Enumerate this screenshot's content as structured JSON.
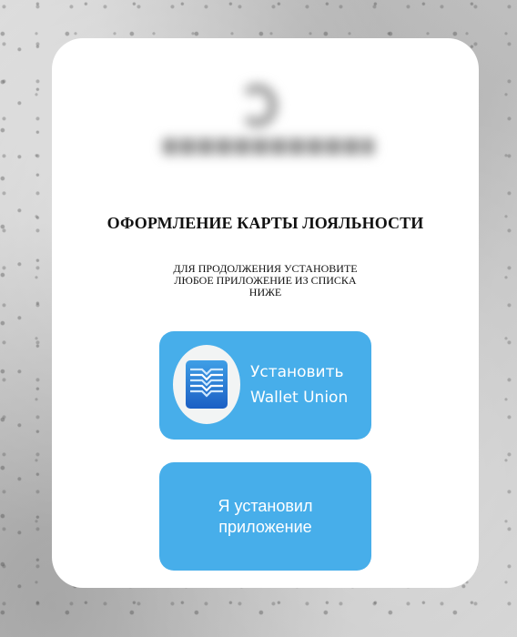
{
  "title": "ОФОРМЛЕНИЕ КАРТЫ ЛОЯЛЬНОСТИ",
  "subtitle": {
    "line1": "ДЛЯ ПРОДОЛЖЕНИЯ УСТАНОВИТЕ",
    "line2": "ЛЮБОЕ ПРИЛОЖЕНИЕ ИЗ СПИСКА",
    "line3": "НИЖЕ"
  },
  "install_button": {
    "line1": "Установить",
    "line2": "Wallet Union",
    "icon": "wallet-union-app-icon"
  },
  "done_button": {
    "line1": "Я установил",
    "line2": "приложение"
  },
  "colors": {
    "button": "#47aeea",
    "card": "#ffffff",
    "text": "#111111"
  }
}
